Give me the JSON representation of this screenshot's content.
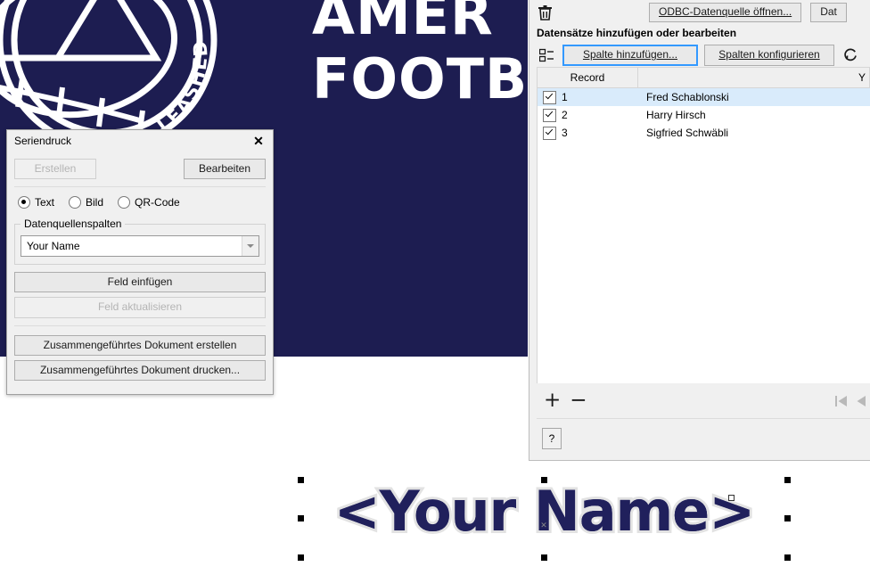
{
  "canvas": {
    "artwork": {
      "brand_line1": "AMER",
      "brand_line2": "FOOTB",
      "logo_arc_text": "LEASHED",
      "navy": "#1d1d51",
      "white": "#ffffff"
    },
    "selected_object": {
      "text": "<Your Name>",
      "fill_color": "#20205c",
      "outline_color": "#e2e2e2"
    }
  },
  "seriendruck_dialog": {
    "title": "Seriendruck",
    "close_label": "✕",
    "create_button": "Erstellen",
    "edit_button": "Bearbeiten",
    "mode_options": [
      {
        "label": "Text",
        "checked": true
      },
      {
        "label": "Bild",
        "checked": false
      },
      {
        "label": "QR-Code",
        "checked": false
      }
    ],
    "fieldset_legend": "Datenquellenspalten",
    "combo_value": "Your Name",
    "insert_field_button": "Feld einfügen",
    "update_field_button": "Feld aktualisieren",
    "create_merged_doc_button": "Zusammengeführtes Dokument erstellen",
    "print_merged_doc_button": "Zusammengeführtes Dokument drucken..."
  },
  "data_panel": {
    "toolbar": {
      "delete_icon": "trash-icon",
      "odbc_button": "ODBC-Datenquelle öffnen...",
      "dat_button": "Dat"
    },
    "section_title": "Datensätze hinzufügen oder bearbeiten",
    "toolbar2": {
      "columns_icon": "columns-list-icon",
      "add_column_button": "Spalte hinzufügen...",
      "configure_columns_button": "Spalten konfigurieren",
      "refresh_icon": "refresh-icon"
    },
    "grid": {
      "headers": [
        "Record",
        "Y"
      ],
      "rows": [
        {
          "checked": true,
          "record": "1",
          "value": "Fred Schablonski",
          "selected": true
        },
        {
          "checked": true,
          "record": "2",
          "value": "Harry Hirsch",
          "selected": false
        },
        {
          "checked": true,
          "record": "3",
          "value": "Sigfried Schwäbli",
          "selected": false
        }
      ]
    },
    "footer": {
      "add_record": "+",
      "remove_record": "−",
      "first_icon": "first-record-icon",
      "prev_icon": "previous-record-icon"
    },
    "help_button": "?"
  }
}
